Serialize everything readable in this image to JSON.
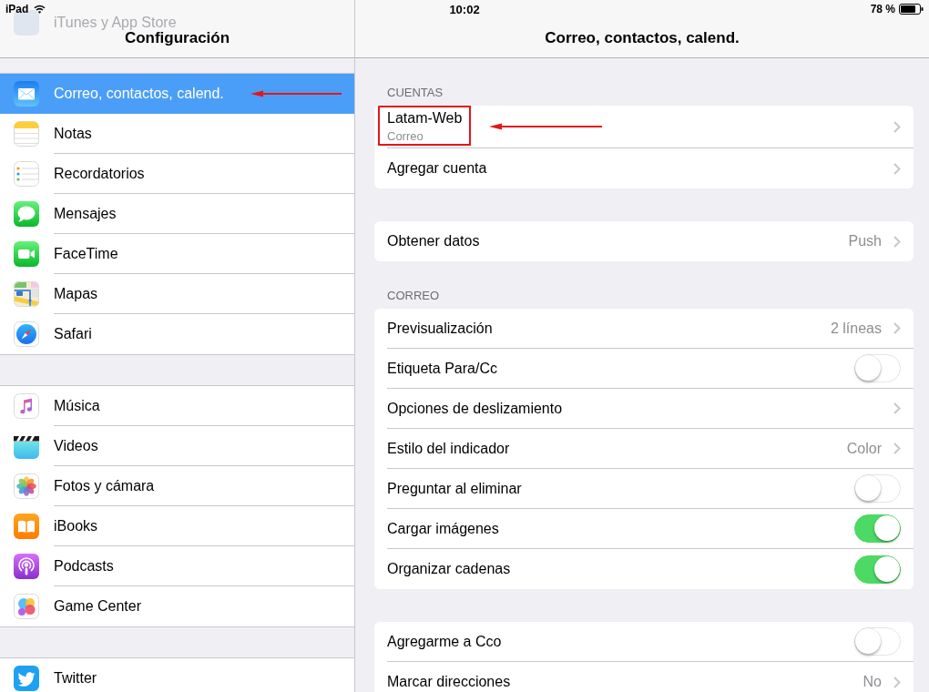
{
  "status_bar": {
    "carrier": "iPad",
    "time": "10:02",
    "battery": "78 %"
  },
  "sidebar": {
    "faded_item": {
      "label": "iTunes y App Store"
    },
    "title": "Configuración",
    "groups": [
      {
        "items": [
          {
            "label": "Correo, contactos, calend.",
            "selected": true,
            "callout": true
          },
          {
            "label": "Notas",
            "selected": false,
            "callout": false
          },
          {
            "label": "Recordatorios",
            "selected": false,
            "callout": false
          },
          {
            "label": "Mensajes",
            "selected": false,
            "callout": false
          },
          {
            "label": "FaceTime",
            "selected": false,
            "callout": false
          },
          {
            "label": "Mapas",
            "selected": false,
            "callout": false
          },
          {
            "label": "Safari",
            "selected": false,
            "callout": false
          }
        ]
      },
      {
        "items": [
          {
            "label": "Música",
            "selected": false,
            "callout": false
          },
          {
            "label": "Videos",
            "selected": false,
            "callout": false
          },
          {
            "label": "Fotos y cámara",
            "selected": false,
            "callout": false
          },
          {
            "label": "iBooks",
            "selected": false,
            "callout": false
          },
          {
            "label": "Podcasts",
            "selected": false,
            "callout": false
          },
          {
            "label": "Game Center",
            "selected": false,
            "callout": false
          }
        ]
      },
      {
        "items": [
          {
            "label": "Twitter",
            "selected": false,
            "callout": false
          }
        ]
      }
    ]
  },
  "detail": {
    "title": "Correo, contactos, calend.",
    "sections": [
      {
        "header": "CUENTAS",
        "rows": [
          {
            "kind": "account",
            "label": "Latam-Web",
            "subtitle": "Correo",
            "boxed": true,
            "callout": true
          },
          {
            "kind": "link",
            "label": "Agregar cuenta",
            "boxed": false,
            "callout": false
          }
        ]
      },
      {
        "rows": [
          {
            "kind": "value",
            "label": "Obtener datos",
            "value": "Push",
            "boxed": false,
            "callout": false
          }
        ]
      },
      {
        "header": "CORREO",
        "rows": [
          {
            "kind": "value",
            "label": "Previsualización",
            "value": "2 líneas",
            "boxed": false,
            "callout": false
          },
          {
            "kind": "toggle",
            "label": "Etiqueta Para/Cc",
            "on": false,
            "boxed": false,
            "callout": false
          },
          {
            "kind": "link",
            "label": "Opciones de deslizamiento",
            "boxed": false,
            "callout": false
          },
          {
            "kind": "value",
            "label": "Estilo del indicador",
            "value": "Color",
            "boxed": false,
            "callout": false
          },
          {
            "kind": "toggle",
            "label": "Preguntar al eliminar",
            "on": false,
            "boxed": false,
            "callout": false
          },
          {
            "kind": "toggle",
            "label": "Cargar imágenes",
            "on": true,
            "boxed": false,
            "callout": false
          },
          {
            "kind": "toggle",
            "label": "Organizar cadenas",
            "on": true,
            "boxed": false,
            "callout": false
          }
        ]
      },
      {
        "rows": [
          {
            "kind": "toggle",
            "label": "Agregarme a Cco",
            "on": false,
            "boxed": false,
            "callout": false
          },
          {
            "kind": "value",
            "label": "Marcar direcciones",
            "value": "No",
            "boxed": false,
            "callout": false
          }
        ]
      }
    ]
  }
}
